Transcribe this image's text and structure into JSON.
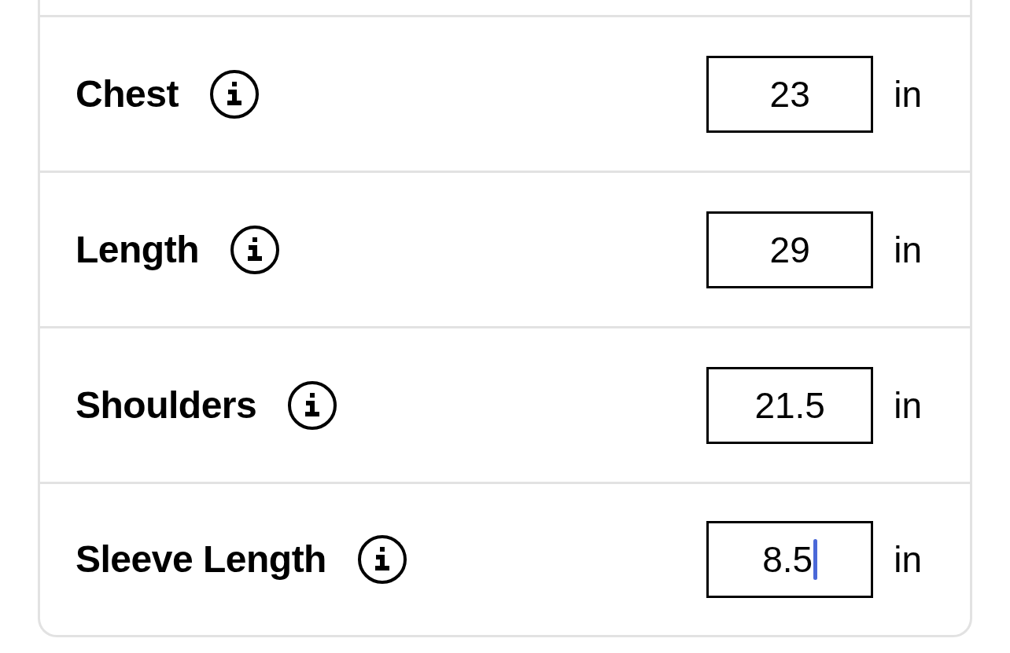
{
  "measurements": [
    {
      "label": "Chest",
      "value": "23",
      "unit": "in",
      "focused": false
    },
    {
      "label": "Length",
      "value": "29",
      "unit": "in",
      "focused": false
    },
    {
      "label": "Shoulders",
      "value": "21.5",
      "unit": "in",
      "focused": false
    },
    {
      "label": "Sleeve Length",
      "value": "8.5",
      "unit": "in",
      "focused": true
    }
  ]
}
